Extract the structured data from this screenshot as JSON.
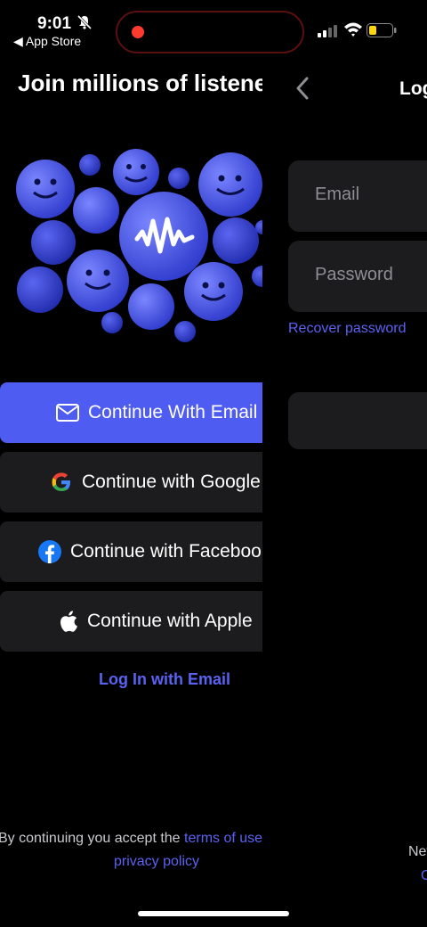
{
  "status_bar": {
    "time": "9:01",
    "back_app": "◀ App Store"
  },
  "left_screen": {
    "title": "Join millions of listeners",
    "buttons": [
      {
        "label": "Continue With Email",
        "icon": "mail-icon"
      },
      {
        "label": "Continue with Google",
        "icon": "google-icon"
      },
      {
        "label": "Continue with Facebook",
        "icon": "facebook-icon"
      },
      {
        "label": "Continue with Apple",
        "icon": "apple-icon"
      }
    ],
    "login_link": "Log In with Email",
    "terms_prefix": "By continuing you accept the ",
    "terms_link": "terms of use",
    "privacy_link": "privacy policy"
  },
  "right_screen": {
    "title": "Log in",
    "email_placeholder": "Email",
    "password_placeholder": "Password",
    "recover_link": "Recover password",
    "footer_text": "New",
    "footer_link": "C"
  },
  "colors": {
    "accent": "#4f5cf2",
    "link": "#5b62f1",
    "surface": "#1c1c1e",
    "background": "#000000"
  }
}
